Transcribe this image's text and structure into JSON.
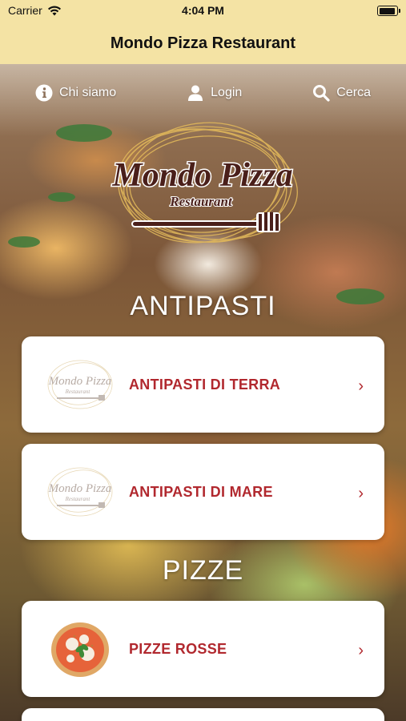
{
  "status_bar": {
    "carrier": "Carrier",
    "time": "4:04 PM"
  },
  "nav": {
    "title": "Mondo Pizza Restaurant"
  },
  "top_menu": {
    "about": "Chi siamo",
    "login": "Login",
    "search": "Cerca"
  },
  "logo": {
    "name_text": "Mondo Pizza",
    "sub_text": "Restaurant"
  },
  "sections": [
    {
      "title": "ANTIPASTI",
      "items": [
        {
          "label": "ANTIPASTI DI TERRA",
          "chevron": "›"
        },
        {
          "label": "ANTIPASTI DI MARE",
          "chevron": "›"
        }
      ]
    },
    {
      "title": "PIZZE",
      "items": [
        {
          "label": "PIZZE ROSSE",
          "chevron": "›"
        }
      ]
    }
  ],
  "colors": {
    "header_bg": "#f4e3a4",
    "item_text": "#b1282e",
    "logo_brown": "#4a1f1a",
    "logo_gold": "#e0b75a"
  }
}
